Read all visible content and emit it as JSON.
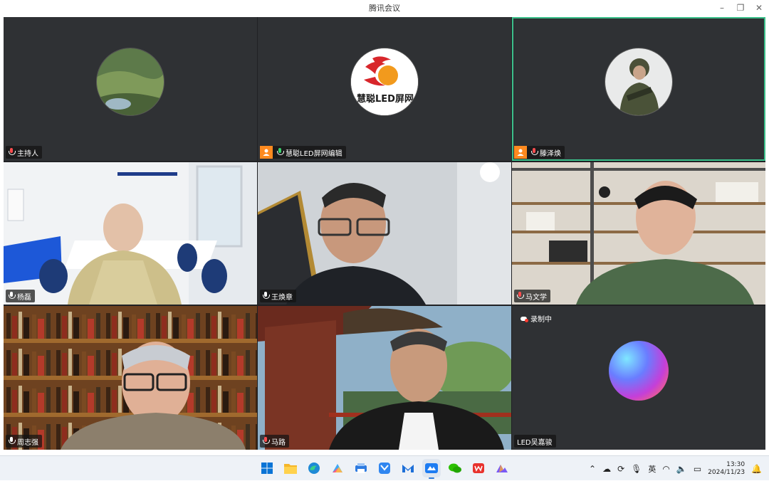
{
  "window": {
    "title": "腾讯会议",
    "controls": [
      "minimize",
      "restore",
      "close"
    ]
  },
  "participants": [
    {
      "name": "主持人",
      "mic": "muted",
      "avatar": "landscape-photo",
      "badge": false
    },
    {
      "name": "慧聪LED屏网编辑",
      "mic": "active",
      "avatar": "brand-logo",
      "avatar_text": "慧聪LED屏网",
      "badge": true
    },
    {
      "name": "滕泽焕",
      "mic": "muted",
      "avatar": "soldier-photo",
      "badge": true,
      "speaking": true
    },
    {
      "name": "杨磊",
      "mic": "on",
      "video": true
    },
    {
      "name": "王焕章",
      "mic": "on",
      "video": true
    },
    {
      "name": "马文学",
      "mic": "muted",
      "video": true
    },
    {
      "name": "周志强",
      "mic": "on",
      "video": true
    },
    {
      "name": "马路",
      "mic": "muted",
      "video": true
    },
    {
      "name": "LED吴嘉骏",
      "mic": "none",
      "avatar": "gradient-orb"
    }
  ],
  "recording": {
    "label": "录制中"
  },
  "taskbar": {
    "apps": [
      "windows-start-icon",
      "file-explorer-icon",
      "edge-icon",
      "photos-icon",
      "printer-app-icon",
      "feishu-icon",
      "email-app-icon",
      "tencent-meeting-icon",
      "wechat-icon",
      "wps-icon",
      "image-tool-icon"
    ],
    "active_app": "tencent-meeting-icon",
    "ime": "英",
    "time": "13:30",
    "date": "2024/11/23"
  },
  "colors": {
    "grid_bg": "#202124",
    "active_speaker": "#3bbf8a",
    "badge": "#ff8a1f",
    "muted": "#ff4d4f"
  }
}
